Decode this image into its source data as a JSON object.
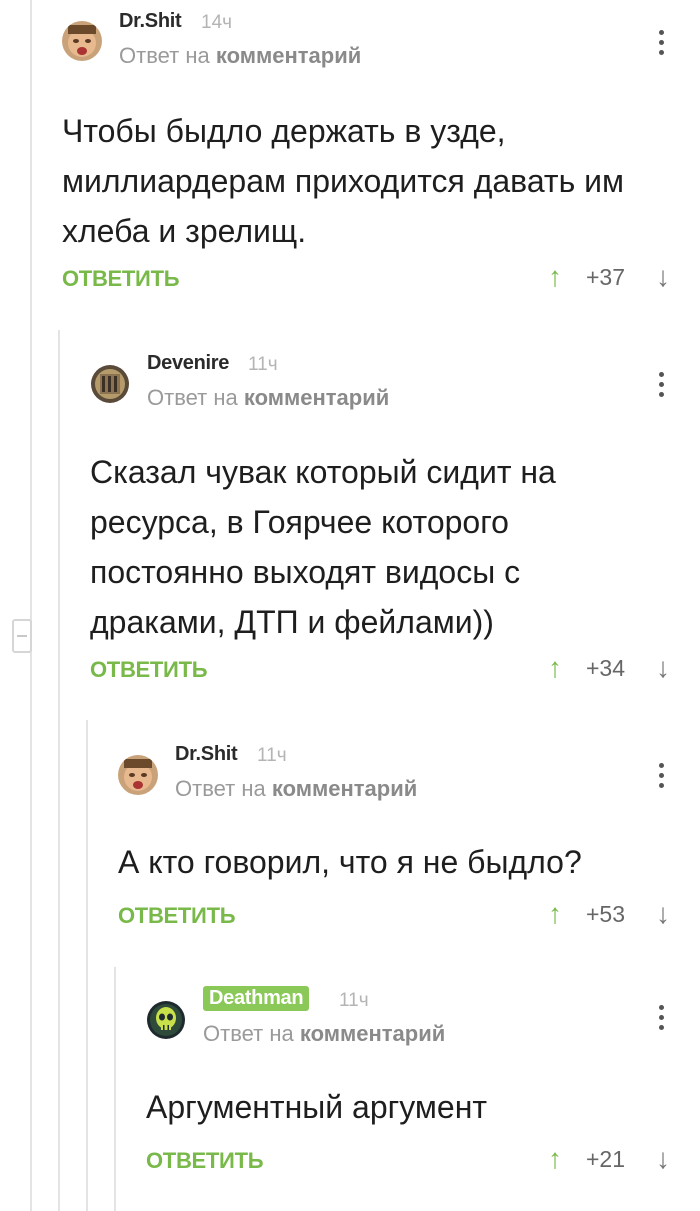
{
  "comments": [
    {
      "username": "Dr.Shit",
      "time": "14ч",
      "reply_prefix": "Ответ на",
      "reply_target": "комментарий",
      "text": "Чтобы быдло держать в узде, миллиардерам приходится давать им хлеба и зрелищ.",
      "reply_label": "ОТВЕТИТЬ",
      "score": "+37",
      "avatar_icon": "crying-baby-avatar"
    },
    {
      "username": "Devenire",
      "time": "11ч",
      "reply_prefix": "Ответ на",
      "reply_target": "комментарий",
      "text": "Сказал чувак который сидит на ресурса, в Гоярчее которого постоянно выходят видосы с драками, ДТП и фейлами))",
      "reply_label": "ОТВЕТИТЬ",
      "score": "+34",
      "avatar_icon": "bronze-medallion-avatar"
    },
    {
      "username": "Dr.Shit",
      "time": "11ч",
      "reply_prefix": "Ответ на",
      "reply_target": "комментарий",
      "text": "А кто говорил, что я не быдло?",
      "reply_label": "ОТВЕТИТЬ",
      "score": "+53",
      "avatar_icon": "crying-baby-avatar"
    },
    {
      "username": "Deathman",
      "time": "11ч",
      "reply_prefix": "Ответ на",
      "reply_target": "комментарий",
      "text": "Аргументный аргумент",
      "reply_label": "ОТВЕТИТЬ",
      "score": "+21",
      "avatar_icon": "green-skull-avatar"
    }
  ],
  "colors": {
    "accent": "#79b94a",
    "badge": "#8ac858",
    "muted": "#9a9a9a"
  }
}
